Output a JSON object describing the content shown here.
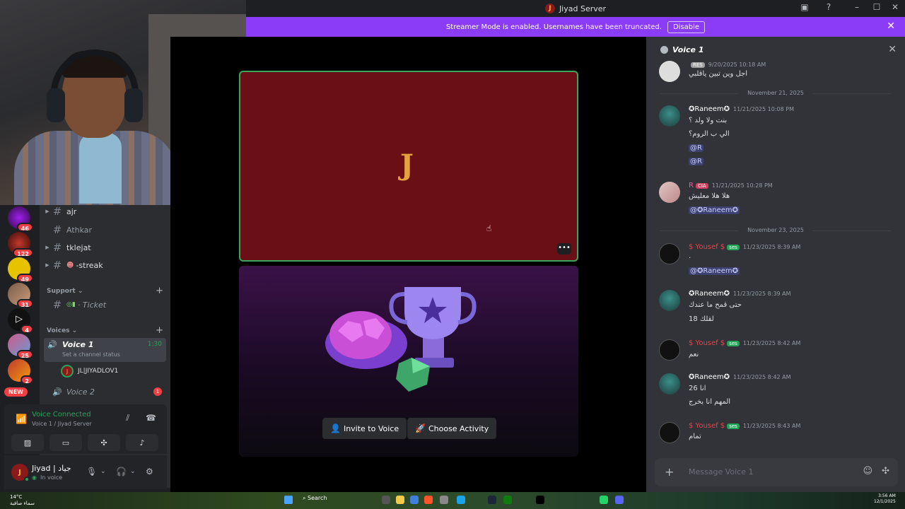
{
  "window": {
    "title": "Jiyad Server",
    "logo_letter": "J"
  },
  "banner": {
    "text": "Streamer Mode is enabled. Usernames have been truncated.",
    "disable_label": "Disable"
  },
  "servers": {
    "badges": [
      "46",
      "122",
      "49",
      "31",
      "4",
      "25",
      "2"
    ],
    "new_label": "NEW"
  },
  "channels": {
    "items": [
      {
        "name": "ajr"
      },
      {
        "name": "Athkar"
      },
      {
        "name": "tklejat"
      },
      {
        "name": "-streak"
      }
    ],
    "support_category": "Support",
    "support_channel": "· Ticket",
    "voices_category": "Voices",
    "voice1": {
      "name": "Voice 1",
      "status": "Set a channel status",
      "time": "1:30"
    },
    "voice1_user": "JL|JIYADLOV1",
    "voice2": {
      "name": "Voice 2",
      "badge": "1"
    }
  },
  "voice_panel": {
    "connected": "Voice Connected",
    "location": "Voice 1 / Jiyad Server"
  },
  "user_panel": {
    "name": "Jiyad | جياد",
    "status": "In voice"
  },
  "stage": {
    "invite_label": "Invite to Voice",
    "activity_label": "Choose Activity",
    "more_label": "•••",
    "tile_glyph": "J"
  },
  "chat": {
    "header": "Voice 1",
    "messages": [
      {
        "user": "",
        "tag": "RES",
        "time": "9/20/2025 10:18 AM",
        "lines": [
          "اجل وين تبين ياقلبي"
        ]
      },
      {
        "divider": "November 21, 2025"
      },
      {
        "user": "✪Raneem✪",
        "time": "11/21/2025 10:08 PM",
        "lines": [
          "بنت ولا ولد ؟",
          "الي ب الروم؟"
        ],
        "mentions": [
          "@R",
          "@R"
        ]
      },
      {
        "user": "R",
        "tag": "CIA",
        "time": "11/21/2025 10:28 PM",
        "lines": [
          "هلا هلا معليش"
        ],
        "mentions": [
          "@✪Raneem✪"
        ]
      },
      {
        "divider": "November 23, 2025"
      },
      {
        "user": "$ Yousef $",
        "tag": "ses",
        "time": "11/23/2025 8:39 AM",
        "lines": [
          "."
        ],
        "mentions": [
          "@✪Raneem✪"
        ]
      },
      {
        "user": "✪Raneem✪",
        "time": "11/23/2025 8:39 AM",
        "lines": [
          "حتى قمح ما عندك",
          "18 لقلك"
        ]
      },
      {
        "user": "$ Yousef $",
        "tag": "ses",
        "time": "11/23/2025 8:42 AM",
        "lines": [
          "نعم"
        ]
      },
      {
        "user": "✪Raneem✪",
        "time": "11/23/2025 8:42 AM",
        "lines": [
          "انا 26",
          "المهم انا بخرج"
        ]
      },
      {
        "user": "$ Yousef $",
        "tag": "ses",
        "time": "11/23/2025 8:43 AM",
        "lines": [
          "تمام"
        ]
      }
    ],
    "composer_placeholder": "Message Voice 1"
  },
  "taskbar": {
    "weather_temp": "14°C",
    "weather_desc": "سماء صافية",
    "search_label": "Search",
    "time": "3:56 AM",
    "date": "12/1/2025"
  },
  "colors": {
    "accent": "#8b3cf7",
    "online": "#23a559",
    "danger": "#f23f43",
    "tile_red": "#6b0f16"
  }
}
